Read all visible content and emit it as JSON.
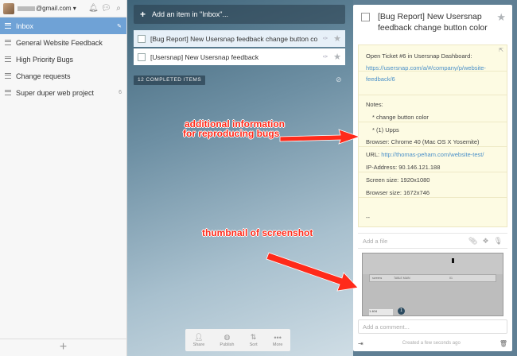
{
  "sidebar": {
    "email_suffix": "@gmail.com",
    "items": [
      {
        "label": "Inbox",
        "count": ""
      },
      {
        "label": "General Website Feedback",
        "count": ""
      },
      {
        "label": "High Priority Bugs",
        "count": ""
      },
      {
        "label": "Change requests",
        "count": ""
      },
      {
        "label": "Super duper web project",
        "count": "6"
      }
    ],
    "add_glyph": "+"
  },
  "main": {
    "add_placeholder": "Add an item in \"Inbox\"...",
    "tasks": [
      {
        "title": "[Bug Report] New Usersnap feedback change button color"
      },
      {
        "title": "[Usersnap] New Usersnap feedback"
      }
    ],
    "completed_label": "12 COMPLETED ITEMS",
    "toolbar": {
      "share": "Share",
      "publish": "Publish",
      "sort": "Sort",
      "more": "More"
    }
  },
  "annotations": {
    "info_line1": "additional information",
    "info_line2": "for reproducing bugs",
    "thumb": "thumbnail of screenshot"
  },
  "detail": {
    "title": "[Bug Report] New Usersnap feedback change button color",
    "note": {
      "open_ticket": "Open Ticket #6 in Usersnap Dashboard:",
      "link1a": "https://usersnap.com/a/#/company/p/website-",
      "link1b": "feedback/6",
      "notes_label": "Notes:",
      "note1": "* change button color",
      "note2": "* (1) Upps",
      "browser": "Browser: Chrome 40 (Mac OS X Yosemite)",
      "url_label": "URL:",
      "url_value": "http://thomas-peham.com/website-test/",
      "ip": "IP-Address: 90.146.121.188",
      "screen": "Screen size: 1920x1080",
      "browser_size": "Browser size: 1672x746",
      "dashes": "--"
    },
    "add_file_placeholder": "Add a file",
    "thumb_text": {
      "col1": "screens",
      "col2": "TABLE MAIN",
      "col3": "01",
      "bottom": "1 404",
      "badge": "1"
    },
    "comment_placeholder": "Add a comment...",
    "created": "Created a few seconds ago"
  }
}
